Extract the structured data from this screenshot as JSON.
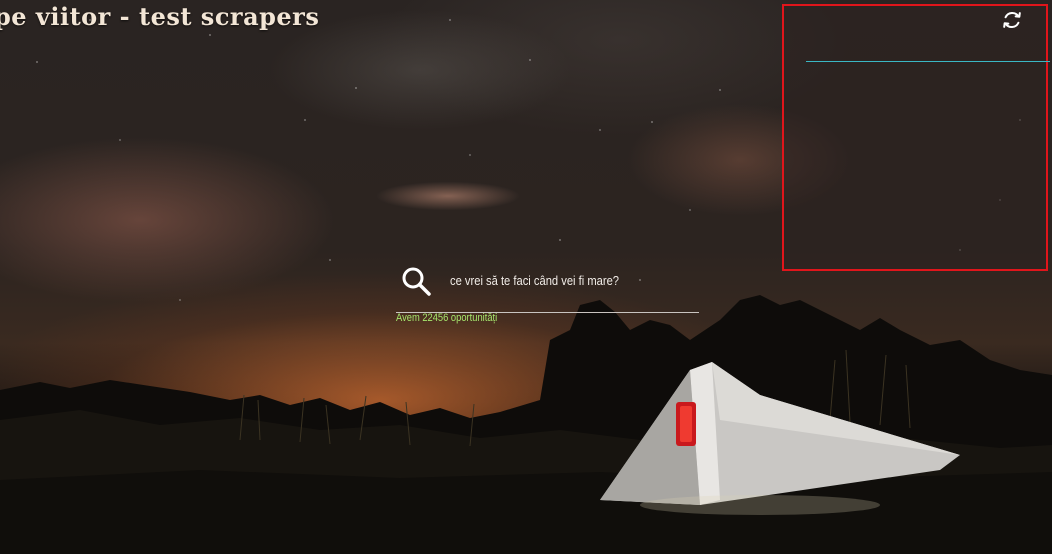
{
  "site": {
    "title": "pe viitor - test scrapers"
  },
  "search": {
    "placeholder": "ce vrei să te faci când vei fi mare?",
    "value": "",
    "icon": "search-icon"
  },
  "results": {
    "text": "Avem 22456 oportunități"
  },
  "panel": {
    "refresh_icon": "refresh-icon",
    "border_color": "#e0151b",
    "line_color": "#3ab7c4"
  },
  "colors": {
    "title": "#f3e6d6",
    "results_text": "#a7e66c"
  }
}
